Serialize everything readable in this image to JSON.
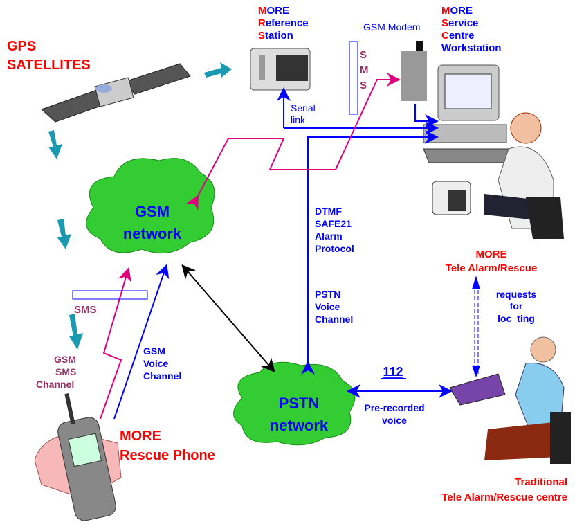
{
  "colors": {
    "red": "#ff0000",
    "blue": "#0000ff",
    "purple": "#993366",
    "magenta": "#e0007f",
    "cloud": "#33cc33",
    "arrow_teal": "#1a9ab0"
  },
  "gps": {
    "line1": "GPS",
    "line2": "SATELLITES"
  },
  "reference_station": {
    "l1_initial": "M",
    "l1_rest": "ORE",
    "l2_initial": "R",
    "l2_rest": "eference",
    "l3_initial": "S",
    "l3_rest": "tation"
  },
  "gsm_modem": {
    "label": "GSM Modem"
  },
  "sms_vertical": {
    "s1": "S",
    "m": "M",
    "s2": "S"
  },
  "service_centre": {
    "l1_initial": "M",
    "l1_rest": "ORE",
    "l2_initial": "S",
    "l2_rest": "ervice",
    "l3_initial": "C",
    "l3_rest": "entre",
    "l4": "Workstation"
  },
  "serial_link": {
    "line1": "Serial",
    "line2": "link"
  },
  "gsm_network": {
    "line1": "GSM",
    "line2": "network"
  },
  "pstn_network": {
    "line1": "PSTN",
    "line2": "network"
  },
  "dtmf": {
    "line1": "DTMF",
    "line2": "SAFE21",
    "line3": "Alarm",
    "line4": "Protocol"
  },
  "pstn_voice": {
    "line1": "PSTN",
    "line2": "Voice",
    "line3": "Channel"
  },
  "more_tele": {
    "line1": "MORE",
    "line2": "Tele Alarm/Rescue"
  },
  "requests": {
    "line1": "requests",
    "line2": "for",
    "line3": "loc  ting"
  },
  "sms_horizontal": {
    "label": "SMS"
  },
  "gsm_sms_channel": {
    "line1": "GSM",
    "line2": "SMS",
    "line3": "Channel"
  },
  "gsm_voice_channel": {
    "line1": "GSM",
    "line2": "Voice",
    "line3": "Channel"
  },
  "emergency": {
    "number": "112",
    "line1": "Pre-recorded",
    "line2": "voice"
  },
  "rescue_phone": {
    "line1": "MORE",
    "line2": "Rescue Phone"
  },
  "traditional": {
    "line1": "Traditional",
    "line2": "Tele Alarm/Rescue centre"
  }
}
